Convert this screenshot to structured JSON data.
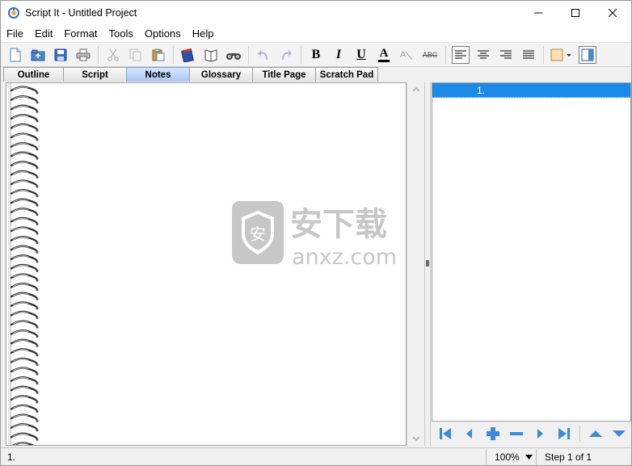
{
  "window": {
    "title": "Script It - Untitled Project",
    "controls": [
      "minimize-icon",
      "maximize-icon",
      "close-icon"
    ]
  },
  "menu": {
    "items": [
      "File",
      "Edit",
      "Format",
      "Tools",
      "Options",
      "Help"
    ]
  },
  "toolbar": {
    "buttons": [
      "new-document-icon",
      "open-icon",
      "save-icon",
      "print-icon",
      "cut-icon",
      "copy-icon",
      "paste-icon",
      "spellcheck-icon",
      "dictionary-icon",
      "find-icon",
      "undo-icon",
      "redo-icon",
      "bold-icon",
      "italic-icon",
      "underline-icon",
      "font-color-icon",
      "clear-format-icon",
      "strikethrough-icon",
      "align-left-icon",
      "align-center-icon",
      "align-right-icon",
      "justify-icon",
      "highlight-color-icon",
      "view-panel-icon"
    ],
    "bold_label": "B",
    "italic_label": "I",
    "underline_label": "U",
    "font_color_label": "A",
    "strikethrough_label": "ABC"
  },
  "tabs": {
    "items": [
      "Outline",
      "Script",
      "Notes",
      "Glossary",
      "Title Page",
      "Scratch Pad"
    ],
    "active": "Notes"
  },
  "steps": {
    "items": [
      "1."
    ],
    "selected_index": 0
  },
  "step_nav": {
    "buttons": [
      "first-step-icon",
      "previous-step-icon",
      "add-step-icon",
      "remove-step-icon",
      "next-step-icon",
      "last-step-icon",
      "move-up-icon",
      "move-down-icon"
    ]
  },
  "watermark": {
    "cn_text": "安下载",
    "domain": "anxz.com",
    "badge": "安"
  },
  "status": {
    "left": "1.",
    "zoom": "100%",
    "step": "Step 1 of 1"
  },
  "colors": {
    "selection": "#1b8ae6",
    "active_tab": "#a9c6f0"
  }
}
